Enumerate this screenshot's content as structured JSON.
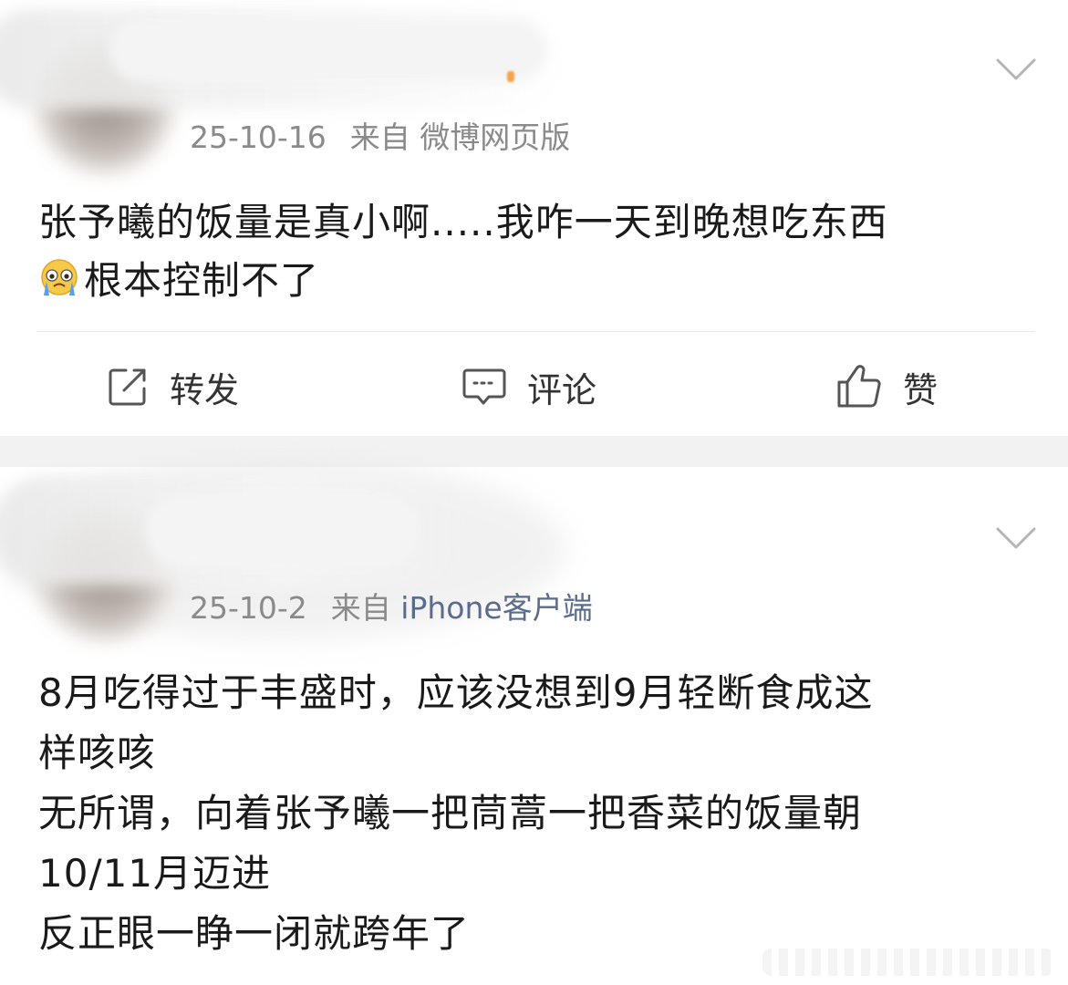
{
  "posts": [
    {
      "date": "25-10-16",
      "from_label": "来自",
      "source": "微博网页版",
      "text_lines": [
        "张予曦的饭量是真小啊.....我咋一天到晚想吃东西",
        "根本控制不了"
      ],
      "emoji": "crying-face-emoji",
      "actions": {
        "repost": "转发",
        "comment": "评论",
        "like": "赞"
      }
    },
    {
      "date": "25-10-2",
      "from_label": "来自",
      "source": "iPhone客户端",
      "text_lines": [
        "8月吃得过于丰盛时，应该没想到9月轻断食成这",
        "样咳咳",
        "无所谓，向着张予曦一把茼蒿一把香菜的饭量朝",
        "10/11月迈进",
        "反正眼一睁一闭就跨年了"
      ]
    }
  ],
  "colors": {
    "text": "#1a1a1a",
    "meta": "#8a8a8a",
    "source_link": "#5b6b8c",
    "divider": "#f2f2f2"
  }
}
